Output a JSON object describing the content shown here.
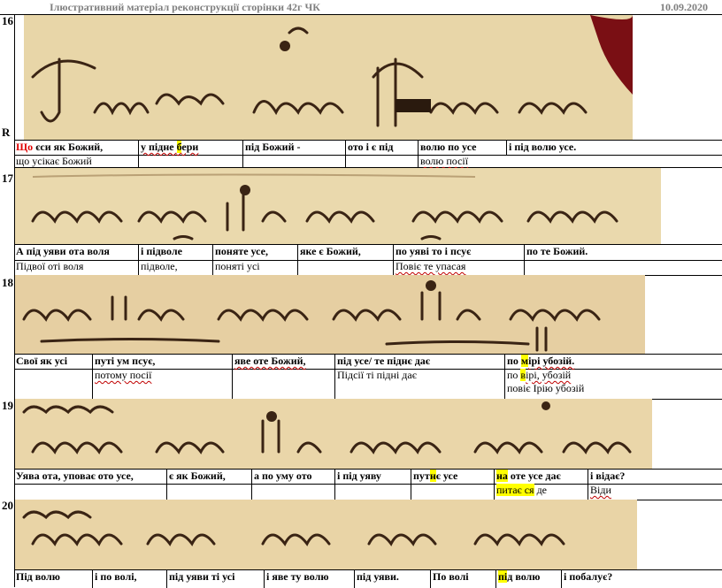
{
  "header": {
    "title": "Ілюстративний матеріал  реконструкції сторінки 42г ЧК",
    "date": "10.09.2020"
  },
  "line_numbers": [
    "16",
    "17",
    "18",
    "19",
    "20"
  ],
  "marker_r": "R",
  "line16": {
    "cells": [
      {
        "pre": "",
        "red": "Що",
        "post": " єси як Божий,"
      },
      {
        "pre": "у підне ",
        "hl": "б",
        "post": "ери"
      },
      {
        "text": "під Божий -"
      },
      {
        "text": "ото і є під"
      },
      {
        "text": "волю по усе"
      },
      {
        "text": "і під волю усе."
      }
    ],
    "sub": [
      "що усікає Божий",
      "волю посії"
    ]
  },
  "line17": {
    "cells": [
      "А під уяви ота воля",
      "і підволе",
      "поняте усе,",
      "яке є Божий,",
      "по уяві то і псує",
      "по те Божий."
    ],
    "sub": [
      "Підвої оті воля",
      "підволе,",
      "поняті усі",
      "Повіє те упасая"
    ]
  },
  "line18": {
    "cells": [
      "Свої як усі",
      "путі ум псує,",
      "яве оте Божий,",
      "під усе/ те піднє дає"
    ],
    "last": {
      "pre": "по ",
      "hl": "м",
      "post": "ірі убозій."
    },
    "sub": [
      "потому посії",
      "Підсії ті підні дає"
    ],
    "sub_last": {
      "pre": "по ",
      "hl": "в",
      "post": "ірі, убозій"
    },
    "sub_last2": "повіє Ірію убозій"
  },
  "line19": {
    "cells": [
      "Уява ота, уповає ото усе,",
      "є як Божий,",
      "а по уму ото",
      "і під уяву"
    ],
    "cell_put": {
      "pre": "пут",
      "hl": "н",
      "post": "є усе"
    },
    "cell_na": {
      "hl": "на",
      "post": " оте усе дає"
    },
    "cell_last": "і відає?",
    "sub_pyt": {
      "hl1": "питає ",
      "hl2": "ся",
      "post": "  де"
    },
    "sub_last": "Віди"
  },
  "line20": {
    "cells": [
      "Під волю",
      "і по волі,",
      "під уяви ті усі",
      "і яве ту волю",
      "під уяви.",
      "По волі"
    ],
    "cell_hl": {
      "pre": "",
      "hl": "пі",
      "post": "д волю"
    },
    "cell_last": "і побалує?"
  },
  "colors": {
    "parchment": "#e6d3a5",
    "ink": "#3a2414",
    "highlight": "#ffff00",
    "accent_red": "#e00000",
    "header_grey": "#7f7f7f"
  }
}
